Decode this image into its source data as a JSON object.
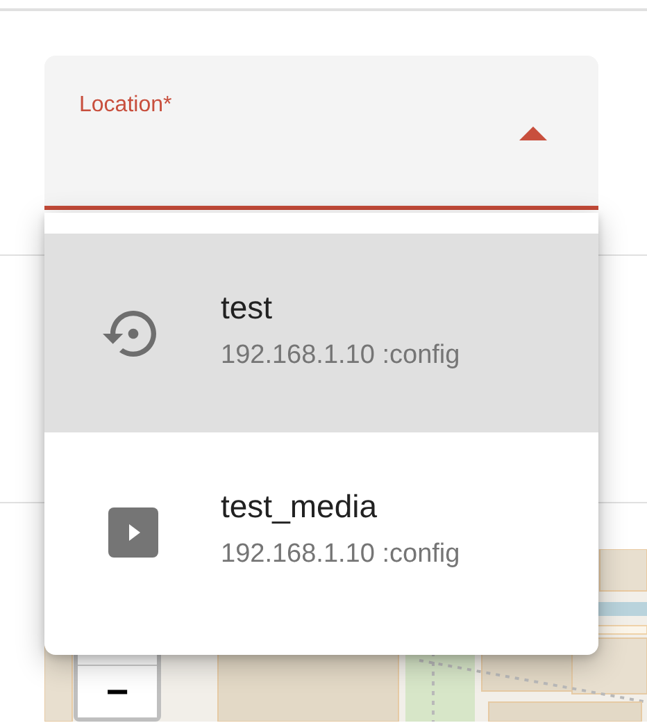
{
  "field": {
    "label": "Location*",
    "focused": true,
    "expanded": true
  },
  "options": [
    {
      "title": "test",
      "subtitle": "192.168.1.10 :config",
      "kind": "restore",
      "selected": true
    },
    {
      "title": "test_media",
      "subtitle": "192.168.1.10 :config",
      "kind": "media",
      "selected": false
    }
  ],
  "map": {
    "kind": "picture",
    "zoom_out": "−"
  }
}
